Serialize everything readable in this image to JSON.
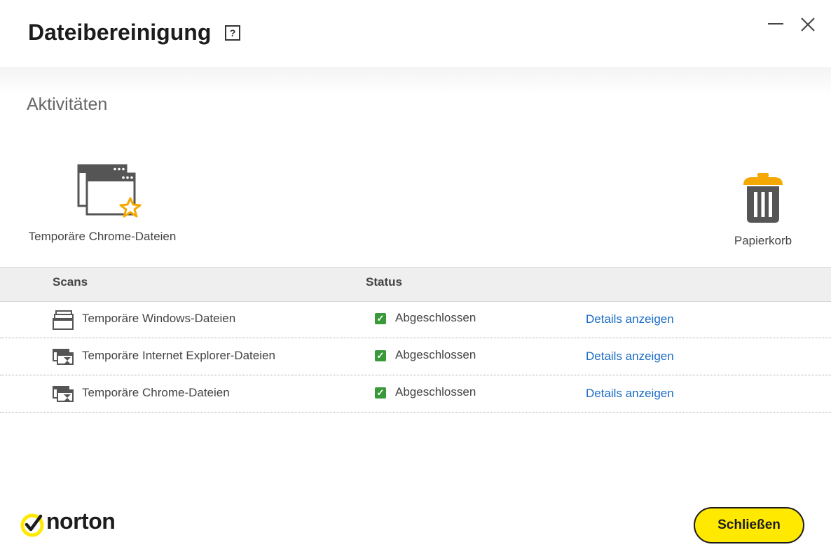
{
  "window": {
    "title": "Dateibereinigung",
    "help_label": "?",
    "minimize_label": "—",
    "close_label": "✕"
  },
  "section_title": "Aktivitäten",
  "activities": [
    {
      "label": "Temporäre Chrome-Dateien",
      "icon": "browser-windows-star-icon"
    },
    {
      "label": "Papierkorb",
      "icon": "trash-bin-icon"
    }
  ],
  "table": {
    "headers": {
      "scans": "Scans",
      "status": "Status"
    },
    "rows": [
      {
        "name": "Temporäre Windows-Dateien",
        "icon": "windows-files-icon",
        "status": "Abgeschlossen",
        "link": "Details anzeigen"
      },
      {
        "name": "Temporäre Internet Explorer-Dateien",
        "icon": "browser-hourglass-icon",
        "status": "Abgeschlossen",
        "link": "Details anzeigen"
      },
      {
        "name": "Temporäre Chrome-Dateien",
        "icon": "browser-hourglass-icon",
        "status": "Abgeschlossen",
        "link": "Details anzeigen"
      }
    ]
  },
  "footer": {
    "brand": "norton",
    "close_button": "Schließen"
  },
  "colors": {
    "accent": "#ffe900",
    "link": "#1a6bc4",
    "success": "#3a9a3a",
    "trash": "#f5a800"
  }
}
